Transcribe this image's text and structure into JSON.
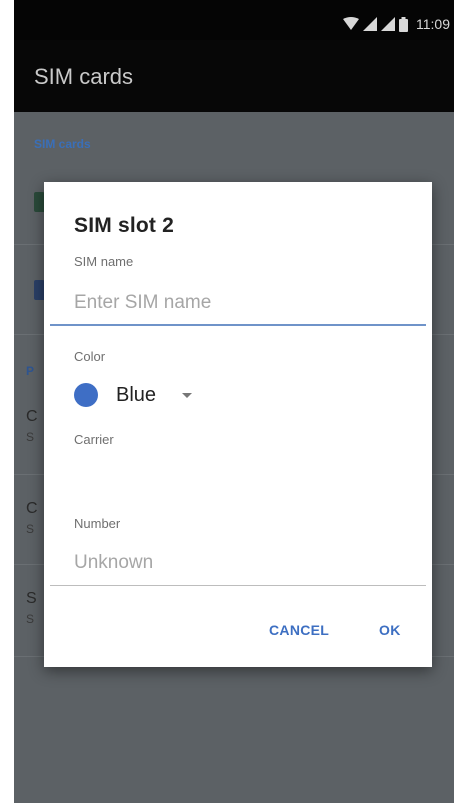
{
  "status_bar": {
    "time": "11:09",
    "icons": [
      "wifi-icon",
      "signal-icon",
      "signal-icon",
      "battery-icon"
    ]
  },
  "toolbar": {
    "title": "SIM cards"
  },
  "background": {
    "section_title": "SIM cards",
    "list_letters": [
      "C",
      "S",
      "C",
      "S",
      "S",
      "S"
    ],
    "pref_letter": "P"
  },
  "dialog": {
    "title": "SIM slot 2",
    "sim_name_label": "SIM name",
    "sim_name_value": "",
    "sim_name_placeholder": "Enter SIM name",
    "color_label": "Color",
    "color_value": "Blue",
    "color_hex": "#3e6ec5",
    "carrier_label": "Carrier",
    "carrier_value": "",
    "number_label": "Number",
    "number_value": "Unknown",
    "cancel_label": "CANCEL",
    "ok_label": "OK"
  },
  "colors": {
    "accent": "#3d6fc2",
    "scrim": "#5c6165",
    "toolbar": "#070707"
  }
}
